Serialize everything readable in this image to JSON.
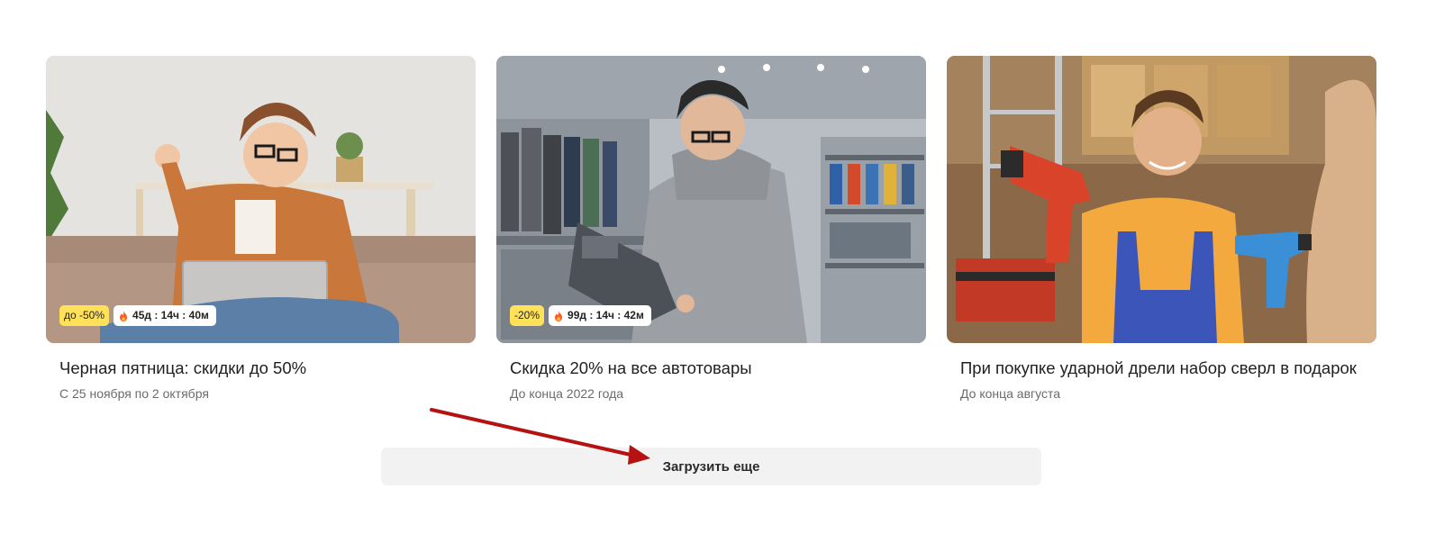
{
  "promotions": [
    {
      "image_alt": "Woman with laptop on sofa",
      "discount_badge": "до -50%",
      "timer": "45д : 14ч : 40м",
      "title": "Черная пятница: скидки до 50%",
      "date": "С 25 ноября по 2 октября"
    },
    {
      "image_alt": "Man choosing motor oil in store",
      "discount_badge": "-20%",
      "timer": "99д : 14ч : 42м",
      "title": "Скидка 20% на все автотовары",
      "date": "До конца 2022 года"
    },
    {
      "image_alt": "Worker holding drills in hardware store",
      "title": "При покупке ударной дрели набор сверл в подарок",
      "date": "До конца августа"
    }
  ],
  "load_more": {
    "label": "Загрузить еще"
  },
  "colors": {
    "discount_badge": "#ffe15a",
    "timer_fire": "#ff5a1f",
    "button_bg": "#f2f2f2",
    "annotation_arrow": "#b51212"
  }
}
